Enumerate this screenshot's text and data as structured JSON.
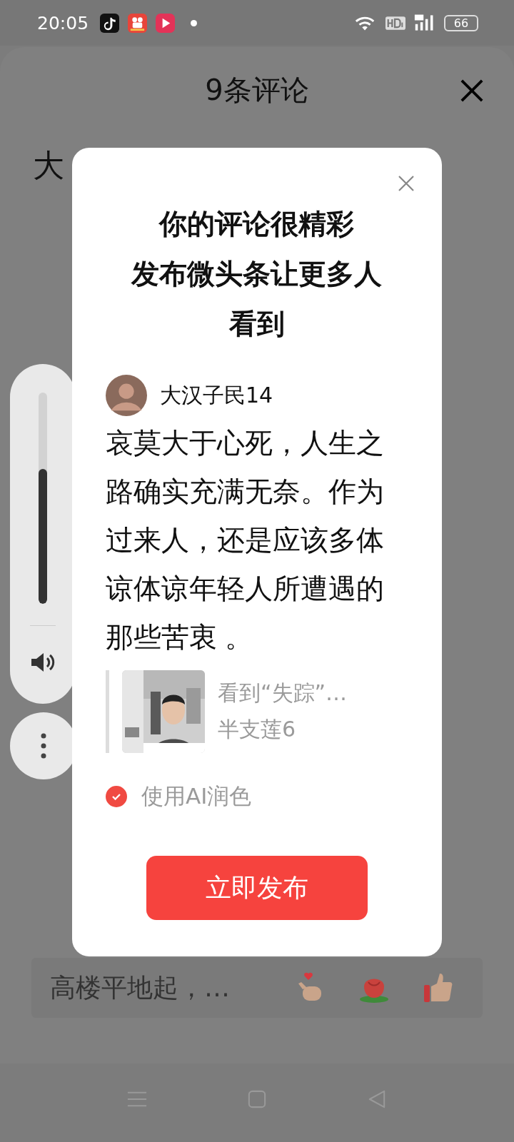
{
  "status_bar": {
    "time": "20:05",
    "battery": "66"
  },
  "sheet": {
    "title": "9条评论",
    "fragment": "大"
  },
  "dialog": {
    "title_lines": [
      "你的评论很精彩",
      "发布微头条让更多人",
      "看到"
    ],
    "author": "大汉子民14",
    "body": "哀莫大于心死，人生之路确实充满无奈。作为过来人，还是应该多体谅体谅年轻人所遭遇的那些苦衷 。",
    "quote": {
      "title": "看到“失踪”…",
      "author": "半支莲6"
    },
    "ai_option": {
      "label": "使用AI润色",
      "checked": true
    },
    "publish_button": "立即发布"
  },
  "volume_panel": {
    "level": 0.64
  },
  "comment_bar": {
    "placeholder": "高楼平地起，…"
  }
}
